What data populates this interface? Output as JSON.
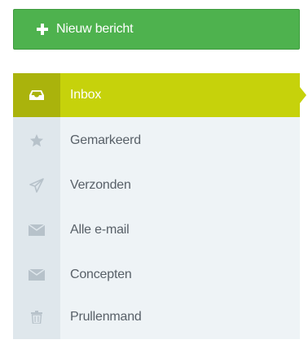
{
  "compose": {
    "label": "Nieuw bericht",
    "icon": "plus-icon",
    "color": "#4eb24e"
  },
  "nav": {
    "active_color": "#c6d20b",
    "items": [
      {
        "label": "Inbox",
        "icon": "inbox-icon",
        "active": true
      },
      {
        "label": "Gemarkeerd",
        "icon": "star-icon",
        "active": false
      },
      {
        "label": "Verzonden",
        "icon": "paper-plane-icon",
        "active": false
      },
      {
        "label": "Alle e-mail",
        "icon": "envelope-icon",
        "active": false
      },
      {
        "label": "Concepten",
        "icon": "envelope-icon",
        "active": false
      },
      {
        "label": "Prullenmand",
        "icon": "trash-icon",
        "active": false
      }
    ]
  }
}
